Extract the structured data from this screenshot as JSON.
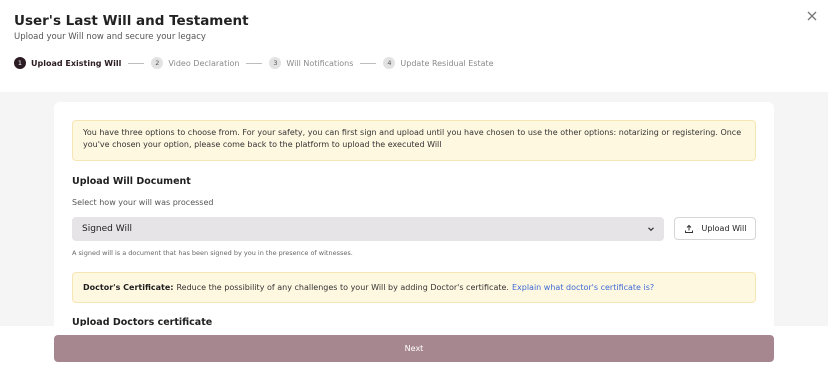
{
  "header": {
    "title": "User's Last Will and Testament",
    "subtitle": "Upload your Will now and secure your legacy",
    "close_icon": "close-icon"
  },
  "steps": [
    {
      "number": "1",
      "label": "Upload Existing Will",
      "active": true
    },
    {
      "number": "2",
      "label": "Video Declaration",
      "active": false
    },
    {
      "number": "3",
      "label": "Will Notifications",
      "active": false
    },
    {
      "number": "4",
      "label": "Update Residual Estate",
      "active": false
    }
  ],
  "info": {
    "text": "You have three options to choose from. For your safety, you can first sign and upload until you have chosen to use the other options: notarizing or registering. Once you've chosen your option, please come back to the platform to upload the executed Will"
  },
  "upload_section": {
    "title": "Upload Will Document",
    "select_label": "Select how your will was processed",
    "select_value": "Signed Will",
    "upload_button": "Upload Will",
    "help_text": "A signed will is a document that has been signed by you in the presence of witnesses."
  },
  "certificate": {
    "strong": "Doctor's Certificate:",
    "text": "Reduce the possibility of any challenges to your Will by adding Doctor's certificate.",
    "link": "Explain what doctor's certificate is?"
  },
  "doctors_section": {
    "title": "Upload Doctors certificate"
  },
  "footer": {
    "next_label": "Next"
  },
  "colors": {
    "accent": "#a6878f",
    "active_step": "#2b1b22",
    "info_bg": "#fff8e1",
    "link": "#3d6bd4"
  }
}
